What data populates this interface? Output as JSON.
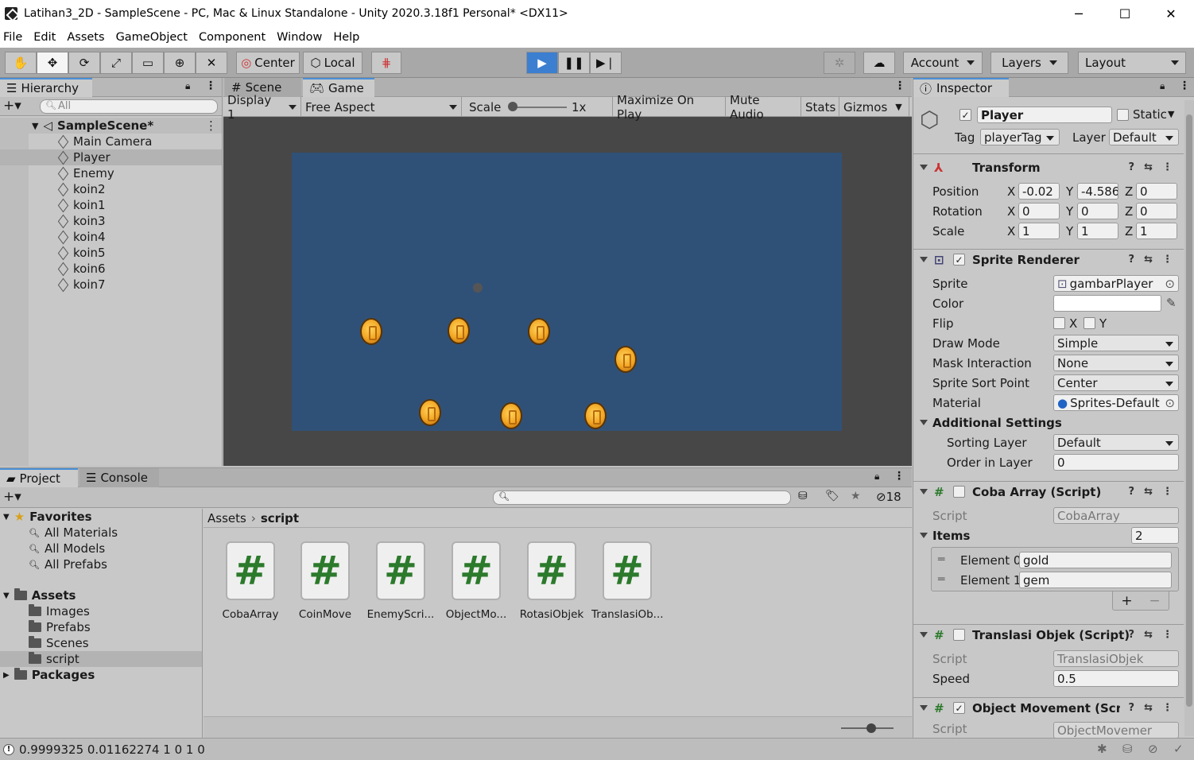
{
  "window": {
    "title": "Latihan3_2D - SampleScene - PC, Mac & Linux Standalone - Unity 2020.3.18f1 Personal* <DX11>",
    "minimize": "─",
    "maximize": "☐",
    "close": "✕"
  },
  "menu": [
    "File",
    "Edit",
    "Assets",
    "GameObject",
    "Component",
    "Window",
    "Help"
  ],
  "toolbar": {
    "tools": [
      "hand-tool",
      "move-tool",
      "rotate-tool",
      "scale-tool",
      "rect-tool",
      "transform-tool",
      "custom-tool"
    ],
    "pivot": "Center",
    "space": "Local",
    "account": "Account",
    "layers": "Layers",
    "layout": "Layout"
  },
  "hierarchy": {
    "tab": "Hierarchy",
    "search_placeholder": "All",
    "scene": "SampleScene*",
    "items": [
      "Main Camera",
      "Player",
      "Enemy",
      "koin2",
      "koin1",
      "koin3",
      "koin4",
      "koin5",
      "koin6",
      "koin7"
    ],
    "selected": "Player"
  },
  "game": {
    "tabs": [
      "Scene",
      "Game"
    ],
    "active_tab": "Game",
    "display": "Display 1",
    "aspect": "Free Aspect",
    "scale_label": "Scale",
    "scale_value": "1x",
    "buttons": [
      "Maximize On Play",
      "Mute Audio",
      "Stats",
      "Gizmos"
    ],
    "background_color": "#305177"
  },
  "project": {
    "tabs": [
      "Project",
      "Console"
    ],
    "active_tab": "Project",
    "hidden_count": "18",
    "favorites": {
      "label": "Favorites",
      "items": [
        "All Materials",
        "All Models",
        "All Prefabs"
      ]
    },
    "assets": {
      "label": "Assets",
      "items": [
        "Images",
        "Prefabs",
        "Scenes",
        "script"
      ]
    },
    "packages": "Packages",
    "breadcrumb": [
      "Assets",
      "script"
    ],
    "files": [
      "CobaArray",
      "CoinMove",
      "EnemyScri...",
      "ObjectMo...",
      "RotasiObjek",
      "TranslasiOb..."
    ]
  },
  "inspector": {
    "tab": "Inspector",
    "name": "Player",
    "static_label": "Static",
    "tag_label": "Tag",
    "tag": "playerTag",
    "layer_label": "Layer",
    "layer": "Default",
    "transform": {
      "title": "Transform",
      "position": {
        "label": "Position",
        "x": "-0.02",
        "y": "-4.586",
        "z": "0"
      },
      "rotation": {
        "label": "Rotation",
        "x": "0",
        "y": "0",
        "z": "0"
      },
      "scale": {
        "label": "Scale",
        "x": "1",
        "y": "1",
        "z": "1"
      }
    },
    "sprite_renderer": {
      "title": "Sprite Renderer",
      "sprite_label": "Sprite",
      "sprite": "gambarPlayer",
      "color_label": "Color",
      "flip_label": "Flip",
      "flip_x": "X",
      "flip_y": "Y",
      "draw_mode_label": "Draw Mode",
      "draw_mode": "Simple",
      "mask_label": "Mask Interaction",
      "mask": "None",
      "sort_point_label": "Sprite Sort Point",
      "sort_point": "Center",
      "material_label": "Material",
      "material": "Sprites-Default",
      "additional": "Additional Settings",
      "sorting_layer_label": "Sorting Layer",
      "sorting_layer": "Default",
      "order_label": "Order in Layer",
      "order": "0"
    },
    "coba_array": {
      "title": "Coba Array (Script)",
      "script_label": "Script",
      "script": "CobaArray",
      "items_label": "Items",
      "items_count": "2",
      "elements": [
        {
          "label": "Element 0",
          "value": "gold"
        },
        {
          "label": "Element 1",
          "value": "gem"
        }
      ],
      "add": "+",
      "remove": "−"
    },
    "translasi": {
      "title": "Translasi Objek (Script)",
      "script_label": "Script",
      "script": "TranslasiObjek",
      "speed_label": "Speed",
      "speed": "0.5"
    },
    "object_movement": {
      "title": "Object Movement (Script",
      "script_label": "Script",
      "script": "ObjectMovemer"
    }
  },
  "status": {
    "message": "0.9999325 0.01162274 1 0 1 0"
  }
}
